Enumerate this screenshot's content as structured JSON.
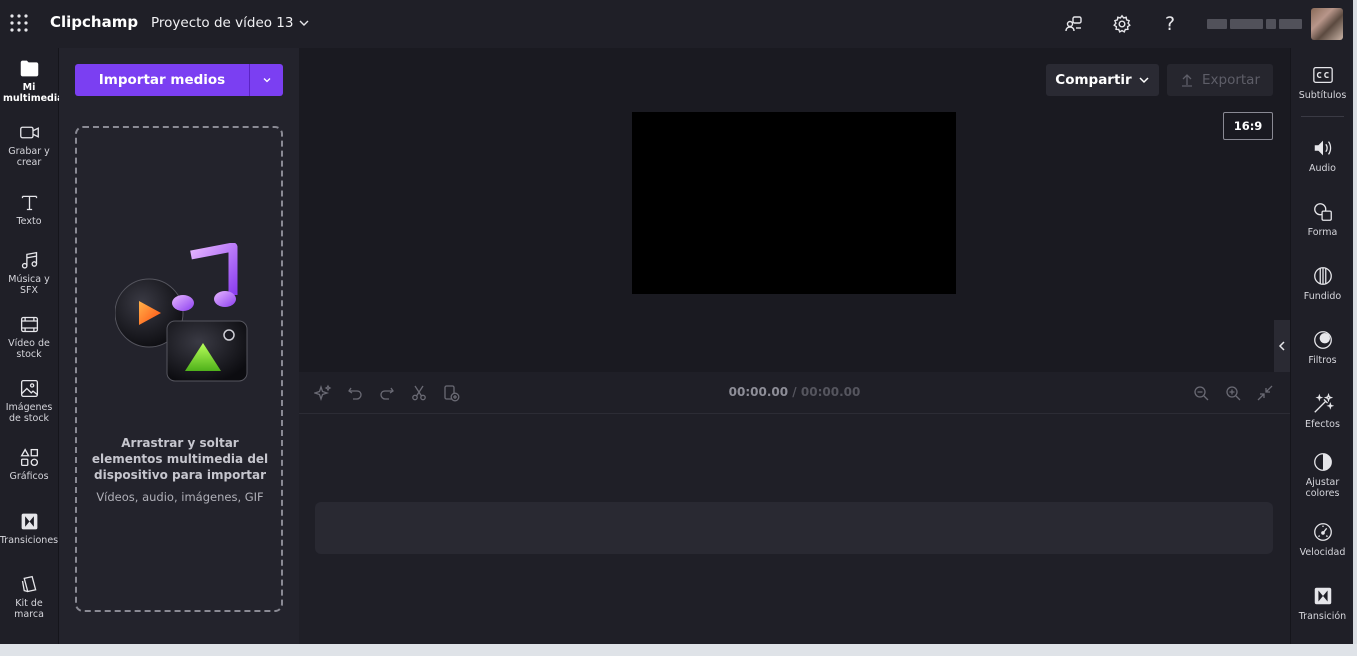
{
  "topbar": {
    "brand": "Clipchamp",
    "project_title": "Proyecto de vídeo 13",
    "icons": [
      "apps-grid-icon",
      "feedback-icon",
      "settings-gear-icon",
      "help-icon"
    ],
    "help_glyph": "?"
  },
  "leftnav": {
    "items": [
      {
        "label": "Mi multimedia",
        "icon": "folder-icon"
      },
      {
        "label": "Grabar y crear",
        "icon": "video-camera-icon"
      },
      {
        "label": "Texto",
        "icon": "text-icon"
      },
      {
        "label": "Música y SFX",
        "icon": "music-note-icon"
      },
      {
        "label": "Vídeo de stock",
        "icon": "film-icon"
      },
      {
        "label": "Imágenes de stock",
        "icon": "image-icon"
      },
      {
        "label": "Gráficos",
        "icon": "shapes-icon"
      },
      {
        "label": "Transiciones",
        "icon": "transition-icon"
      },
      {
        "label": "Kit de marca",
        "icon": "brand-kit-icon"
      }
    ]
  },
  "media": {
    "import_label": "Importar medios",
    "drop_title": "Arrastrar y soltar elementos multimedia del dispositivo para importar",
    "drop_subtitle": "Vídeos, audio, imágenes, GIF"
  },
  "preview": {
    "share_label": "Compartir",
    "export_label": "Exportar",
    "aspect_ratio": "16:9"
  },
  "timeline": {
    "current_time": "00:00.00",
    "separator": " / ",
    "total_time": "00:00.00"
  },
  "rightnav": {
    "items": [
      {
        "label": "Subtítulos",
        "icon": "captions-icon"
      },
      {
        "label": "Audio",
        "icon": "speaker-icon"
      },
      {
        "label": "Forma",
        "icon": "shape-icon"
      },
      {
        "label": "Fundido",
        "icon": "fade-icon"
      },
      {
        "label": "Filtros",
        "icon": "filters-icon"
      },
      {
        "label": "Efectos",
        "icon": "magic-wand-icon"
      },
      {
        "label": "Ajustar colores",
        "icon": "contrast-icon"
      },
      {
        "label": "Velocidad",
        "icon": "speedometer-icon"
      },
      {
        "label": "Transición",
        "icon": "transition-icon"
      }
    ]
  },
  "colors": {
    "accent": "#7b3ff2",
    "background": "#1f1f27",
    "panel": "#23232c",
    "preview_bg": "#1a1a21"
  }
}
